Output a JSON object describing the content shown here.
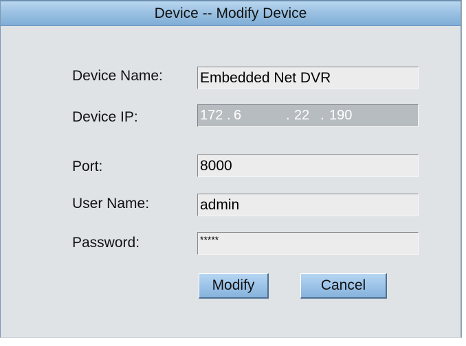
{
  "dialog": {
    "title": "Device -- Modify Device"
  },
  "form": {
    "device_name": {
      "label": "Device Name:",
      "value": "Embedded Net DVR"
    },
    "device_ip": {
      "label": "Device IP:",
      "octets": [
        "172",
        "6",
        "22",
        "190"
      ]
    },
    "port": {
      "label": "Port:",
      "value": "8000"
    },
    "user_name": {
      "label": "User Name:",
      "value": "admin"
    },
    "password": {
      "label": "Password:",
      "value": "*****"
    }
  },
  "buttons": {
    "modify_label": "Modify",
    "cancel_label": "Cancel"
  }
}
